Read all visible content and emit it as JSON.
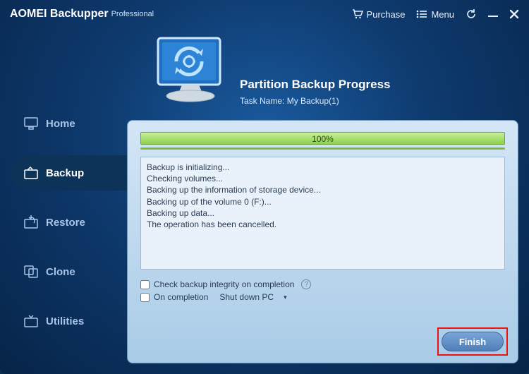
{
  "app": {
    "name": "AOMEI Backupper",
    "edition": "Professional"
  },
  "titlebar": {
    "purchase": "Purchase",
    "menu": "Menu"
  },
  "sidebar": {
    "items": [
      {
        "label": "Home"
      },
      {
        "label": "Backup"
      },
      {
        "label": "Restore"
      },
      {
        "label": "Clone"
      },
      {
        "label": "Utilities"
      }
    ]
  },
  "main": {
    "title": "Partition Backup Progress",
    "task_name_label": "Task Name:",
    "task_name_value": "My Backup(1)",
    "progress_percent": "100%",
    "log": [
      "Backup is initializing...",
      "Checking volumes...",
      "Backing up the information of storage device...",
      "Backing up of the volume 0 (F:)...",
      "Backing up data...",
      "The operation has been cancelled."
    ],
    "opt_integrity": "Check backup integrity on completion",
    "opt_on_completion": "On completion",
    "opt_shutdown": "Shut down PC",
    "finish": "Finish",
    "help_badge": "?"
  }
}
